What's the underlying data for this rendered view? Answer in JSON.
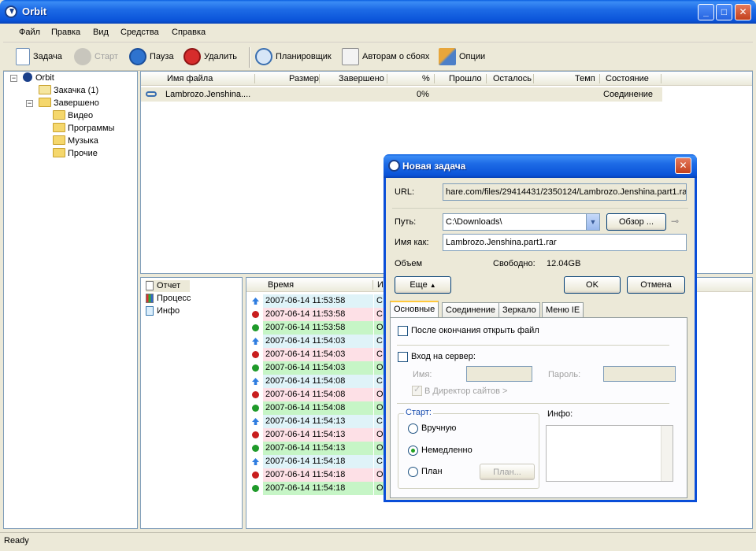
{
  "window": {
    "title": "Orbit",
    "buttons": {
      "minimize": "_",
      "maximize": "□",
      "close": "✕"
    }
  },
  "menu": [
    "Файл",
    "Правка",
    "Вид",
    "Средства",
    "Справка"
  ],
  "toolbar": {
    "new_task": "Задача",
    "start": "Старт",
    "pause": "Пауза",
    "delete": "Удалить",
    "scheduler": "Планировщик",
    "authors": "Авторам о сбоях",
    "options": "Опции"
  },
  "tree": {
    "root": "Orbit",
    "downloading": "Закачка",
    "downloading_count": "(1)",
    "completed": "Завершено",
    "folders": [
      "Видео",
      "Программы",
      "Музыка",
      "Прочие"
    ]
  },
  "filelist": {
    "columns": [
      "Имя файла",
      "Размер",
      "Завершено",
      "%",
      "Прошло",
      "Осталось",
      "Темп",
      "Состояние"
    ],
    "rows": [
      {
        "name": "Lambrozo.Jenshina....",
        "size": "",
        "done": "",
        "percent": "0%",
        "elapsed": "",
        "left": "",
        "speed": "",
        "status": "Соединение"
      }
    ]
  },
  "sidetabs": [
    "Отчет",
    "Процесс",
    "Инфо"
  ],
  "log": {
    "columns": [
      "Время",
      "И"
    ],
    "rows": [
      {
        "type": "info",
        "time": "2007-06-14 11:53:58",
        "msg": "С"
      },
      {
        "type": "error",
        "time": "2007-06-14 11:53:58",
        "msg": "С"
      },
      {
        "type": "ok",
        "time": "2007-06-14 11:53:58",
        "msg": "О"
      },
      {
        "type": "info",
        "time": "2007-06-14 11:54:03",
        "msg": "С"
      },
      {
        "type": "error",
        "time": "2007-06-14 11:54:03",
        "msg": "С"
      },
      {
        "type": "ok",
        "time": "2007-06-14 11:54:03",
        "msg": "О"
      },
      {
        "type": "info",
        "time": "2007-06-14 11:54:08",
        "msg": "С"
      },
      {
        "type": "error",
        "time": "2007-06-14 11:54:08",
        "msg": "О"
      },
      {
        "type": "ok",
        "time": "2007-06-14 11:54:08",
        "msg": "О"
      },
      {
        "type": "info",
        "time": "2007-06-14 11:54:13",
        "msg": "С"
      },
      {
        "type": "error",
        "time": "2007-06-14 11:54:13",
        "msg": "О"
      },
      {
        "type": "ok",
        "time": "2007-06-14 11:54:13",
        "msg": "О"
      },
      {
        "type": "info",
        "time": "2007-06-14 11:54:18",
        "msg": "С"
      },
      {
        "type": "error",
        "time": "2007-06-14 11:54:18",
        "msg": "О"
      },
      {
        "type": "ok",
        "time": "2007-06-14 11:54:18",
        "msg": "О"
      }
    ]
  },
  "status": "Ready",
  "dialog": {
    "title": "Новая задача",
    "url_label": "URL:",
    "url_value": "hare.com/files/29414431/2350124/Lambrozo.Jenshina.part1.rar",
    "path_label": "Путь:",
    "path_value": "C:\\Downloads\\",
    "browse": "Обзор ...",
    "name_label": "Имя как:",
    "name_value": "Lambrozo.Jenshina.part1.rar",
    "size_label": "Объем",
    "free_label": "Свободно:",
    "free_value": "12.04GB",
    "more": "Еще",
    "ok": "OK",
    "cancel": "Отмена",
    "tabs": [
      "Основные",
      "Соединение",
      "Зеркало",
      "Меню IE"
    ],
    "open_after": "После окончания открыть файл",
    "server_login": "Вход на сервер:",
    "user_label": "Имя:",
    "password_label": "Пароль:",
    "site_director": "В Директор сайтов >",
    "start_group": "Старт:",
    "manual": "Вручную",
    "immediately": "Немедленно",
    "plan": "План",
    "plan_button": "План...",
    "info_label": "Инфо:"
  },
  "colors": {
    "info_row": "#dff3f8",
    "error_row": "#fde0e6",
    "ok_row": "#c6f5c6",
    "title_blue": "#0a53d8"
  }
}
